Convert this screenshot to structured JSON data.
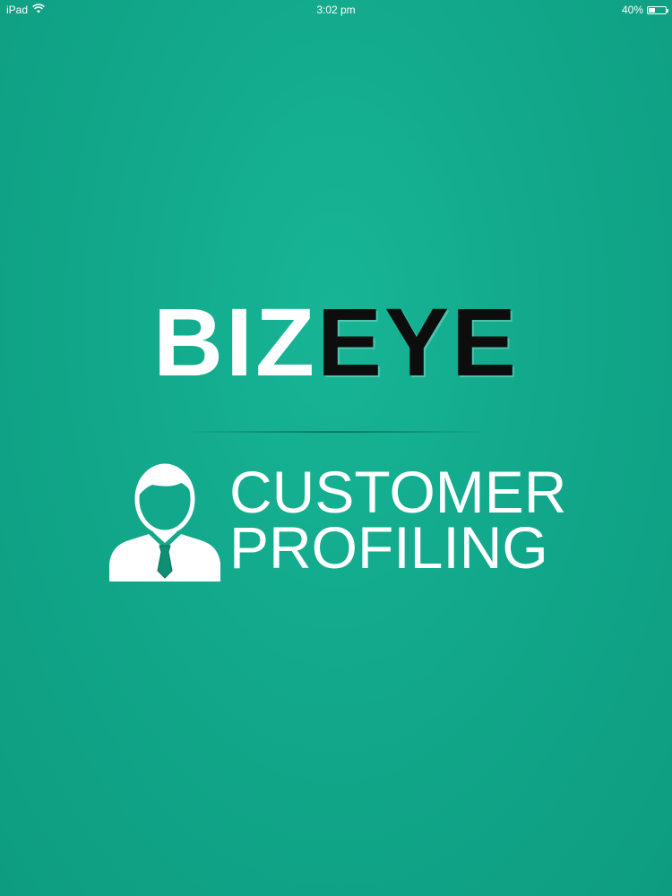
{
  "status_bar": {
    "device": "iPad",
    "time": "3:02 pm",
    "battery_percent": "40%",
    "battery_level": 0.4,
    "wifi_icon": "wifi-icon",
    "battery_icon": "battery-icon"
  },
  "logo": {
    "part_1": "BIZ",
    "part_2": "EYE"
  },
  "subtitle": {
    "line_1": "CUSTOMER",
    "line_2": "PROFILING"
  },
  "icons": {
    "profile": "businessman-icon"
  },
  "colors": {
    "background": "#12a88b",
    "logo_white": "#ffffff",
    "logo_dark": "#0d0d0d",
    "tie": "#0e8f74"
  }
}
